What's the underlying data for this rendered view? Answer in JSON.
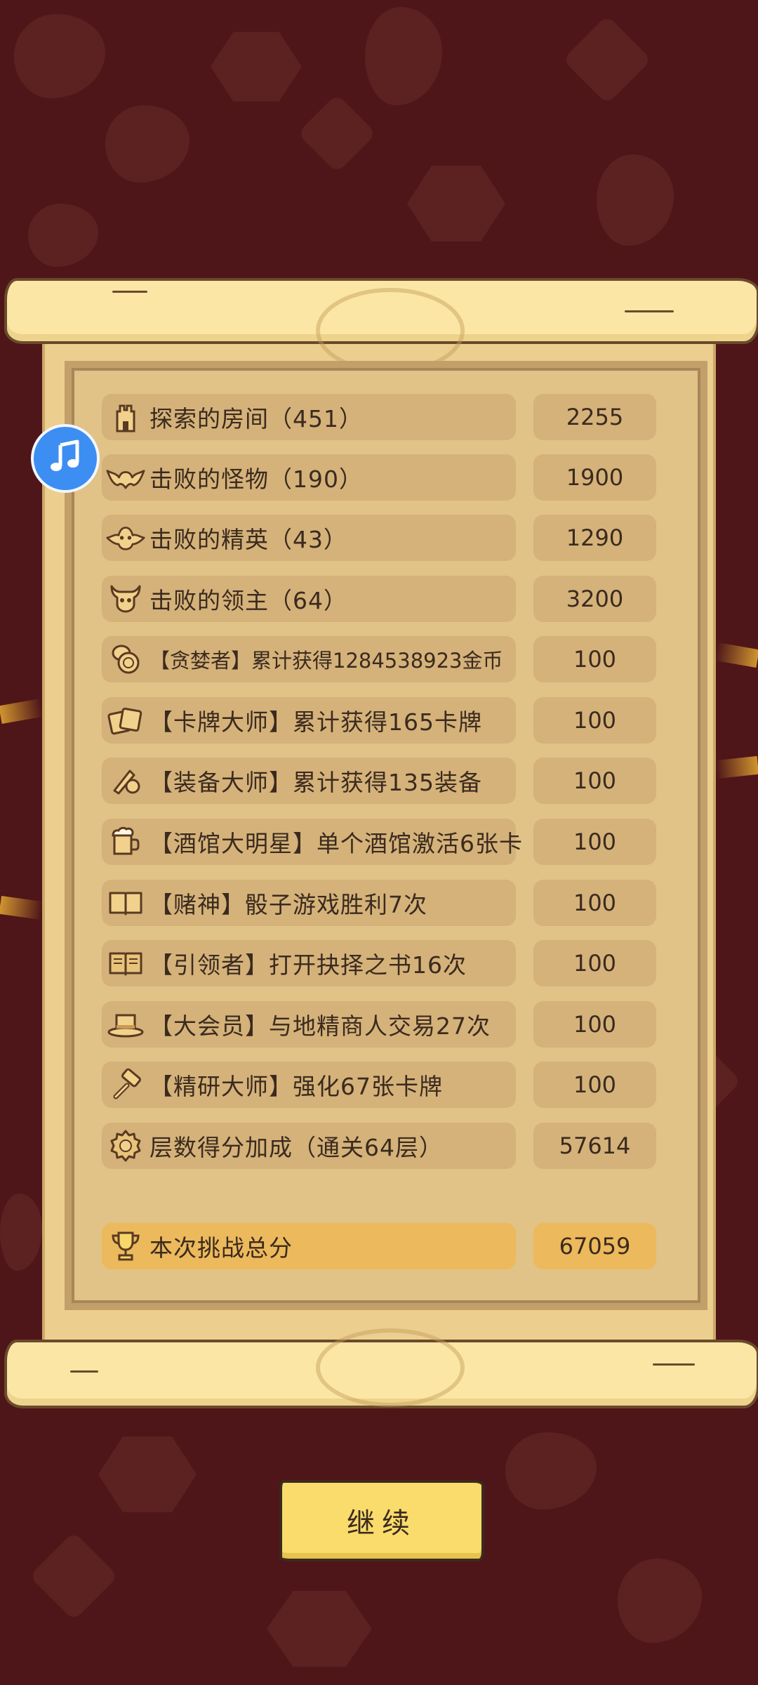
{
  "rows": [
    {
      "icon": "castle-tower-icon",
      "label": "探索的房间（451）",
      "value": "2255"
    },
    {
      "icon": "bat-icon",
      "label": "击败的怪物（190）",
      "value": "1900"
    },
    {
      "icon": "demon-face-icon",
      "label": "击败的精英（43）",
      "value": "1290"
    },
    {
      "icon": "horned-skull-icon",
      "label": "击败的领主（64）",
      "value": "3200"
    },
    {
      "icon": "coin-stack-icon",
      "label": "【贪婪者】累计获得1284538923金币",
      "value": "100"
    },
    {
      "icon": "cards-icon",
      "label": "【卡牌大师】累计获得165卡牌",
      "value": "100"
    },
    {
      "icon": "equipment-icon",
      "label": "【装备大师】累计获得135装备",
      "value": "100"
    },
    {
      "icon": "beer-mug-icon",
      "label": "【酒馆大明星】单个酒馆激活6张卡",
      "value": "100"
    },
    {
      "icon": "book-icon",
      "label": "【赌神】骰子游戏胜利7次",
      "value": "100"
    },
    {
      "icon": "open-book-icon",
      "label": "【引领者】打开抉择之书16次",
      "value": "100"
    },
    {
      "icon": "top-hat-icon",
      "label": "【大会员】与地精商人交易27次",
      "value": "100"
    },
    {
      "icon": "hammer-icon",
      "label": "【精研大师】强化67张卡牌",
      "value": "100"
    },
    {
      "icon": "lion-badge-icon",
      "label": "层数得分加成（通关64层）",
      "value": "57614"
    }
  ],
  "total": {
    "icon": "trophy-icon",
    "label": "本次挑战总分",
    "value": "67059"
  },
  "continue_label": "继续",
  "music_icon": "music-note-icon",
  "colors": {
    "background": "#4e1618",
    "parchment": "#eccf8f",
    "row": "#d4b27a",
    "total_row": "#ecb95c",
    "button": "#f9dc6b",
    "music_button": "#3d8ef2"
  }
}
